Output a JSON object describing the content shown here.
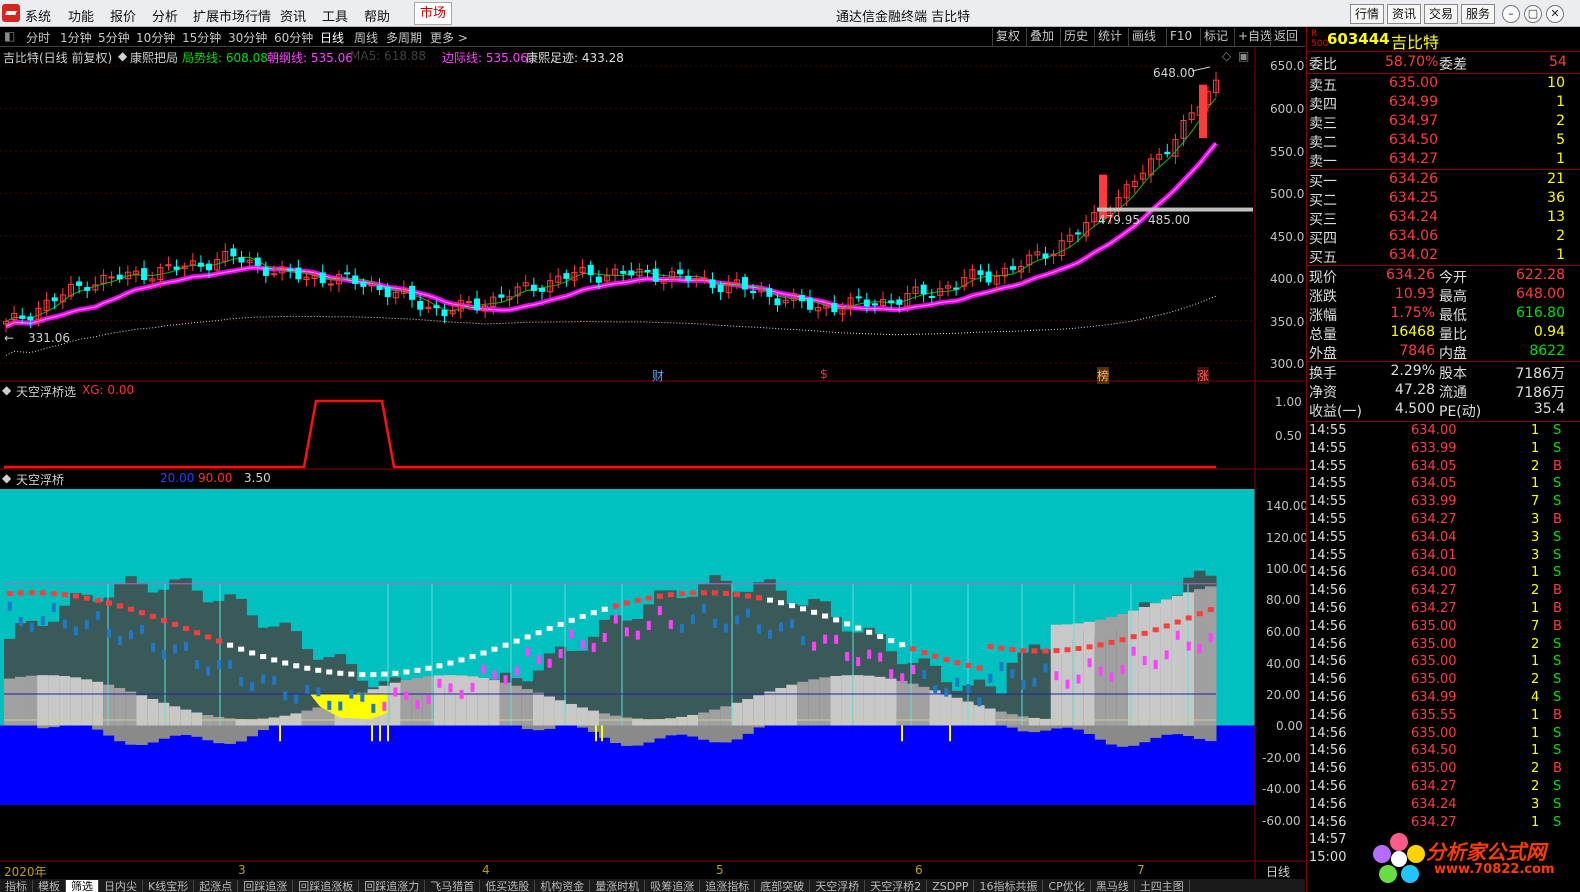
{
  "menu": {
    "items": [
      "系统",
      "功能",
      "报价",
      "分析",
      "扩展市场行情",
      "资讯",
      "工具",
      "帮助"
    ],
    "market": "市场",
    "title": "通达信金融终端  吉比特",
    "right_buttons": [
      "行情",
      "资讯",
      "交易",
      "服务"
    ],
    "window_controls": [
      "–",
      "▢",
      "✕"
    ]
  },
  "periods": {
    "items": [
      "分时",
      "1分钟",
      "5分钟",
      "10分钟",
      "15分钟",
      "30分钟",
      "60分钟",
      "日线",
      "周线",
      "多周期",
      "更多 >"
    ],
    "active": "日线",
    "tools": [
      "复权",
      "叠加",
      "历史",
      "统计",
      "画线",
      "F10",
      "标记",
      "+自选",
      "返回"
    ]
  },
  "main_panel": {
    "stock_label": "吉比特(日线 前复权)",
    "indicator_name": "康熙把局",
    "lines": [
      {
        "label": "局势线: 608.08",
        "color": "#00e000"
      },
      {
        "label": "朝纲线: 535.06",
        "color": "#ff40ff"
      },
      {
        "label": "MA5: 618.88",
        "color": "#404040"
      },
      {
        "label": "边际线: 535.06",
        "color": "#ff40ff"
      },
      {
        "label": "康熙足迹: 433.28",
        "color": "#e0e0e0"
      }
    ],
    "high_marker": "648.00",
    "low_marker": "331.06",
    "box_label": "479.95",
    "box_label2": "485.00",
    "axis": [
      "650.0",
      "600.0",
      "550.0",
      "500.0",
      "450.0",
      "400.0",
      "350.0",
      "300.0"
    ],
    "event_markers": [
      {
        "text": "财",
        "color": "#4da6ff"
      },
      {
        "text": "$",
        "color": "#ff3030"
      },
      {
        "text": "榜",
        "color": "#ffb060"
      },
      {
        "text": "涨",
        "color": "#ff6060"
      }
    ]
  },
  "panel2": {
    "name": "天空浮桥选",
    "value": "XG: 0.00",
    "axis": [
      "1.00",
      "0.50"
    ]
  },
  "panel3": {
    "name": "天空浮桥",
    "values": [
      "20.00",
      "90.00",
      "3.50"
    ],
    "axis": [
      "140.00",
      "120.00",
      "100.00",
      "80.00",
      "60.00",
      "40.00",
      "20.00",
      "0.00",
      "-20.00",
      "-40.00",
      "-60.00"
    ]
  },
  "date_axis": [
    "2020年",
    "3",
    "4",
    "5",
    "6",
    "7"
  ],
  "date_axis_right": "日线",
  "bottom_tabs": [
    "指标",
    "模板",
    "筛选",
    "日内尖",
    "K线宝形",
    "起涨点",
    "回踩追涨",
    "回踩追涨板",
    "回踩追涨力",
    "飞马猎首",
    "低买选股",
    "机构资金",
    "量涨时机",
    "吸筹追涨",
    "追涨指标",
    "底部突破",
    "天空浮桥",
    "天空浮桥2",
    "ZSDPP",
    "16指标共振",
    "CP优化",
    "黑马线",
    "土四主图"
  ],
  "bottom_active": "筛选",
  "quote": {
    "badge_top": "R",
    "badge_bot": "500",
    "code": "603444",
    "name": "吉比特",
    "wb": {
      "label": "委比",
      "value": "58.70%",
      "label2": "委差",
      "value2": "54"
    },
    "sell": [
      {
        "label": "卖五",
        "price": "635.00",
        "vol": "10"
      },
      {
        "label": "卖四",
        "price": "634.99",
        "vol": "1"
      },
      {
        "label": "卖三",
        "price": "634.97",
        "vol": "2"
      },
      {
        "label": "卖二",
        "price": "634.50",
        "vol": "5"
      },
      {
        "label": "卖一",
        "price": "634.27",
        "vol": "1"
      }
    ],
    "buy": [
      {
        "label": "买一",
        "price": "634.26",
        "vol": "21"
      },
      {
        "label": "买二",
        "price": "634.25",
        "vol": "36"
      },
      {
        "label": "买三",
        "price": "634.24",
        "vol": "13"
      },
      {
        "label": "买四",
        "price": "634.06",
        "vol": "2"
      },
      {
        "label": "买五",
        "price": "634.02",
        "vol": "1"
      }
    ],
    "stats1": [
      {
        "l1": "现价",
        "v1": "634.26",
        "c1": "red",
        "l2": "今开",
        "v2": "622.28",
        "c2": "red"
      },
      {
        "l1": "涨跌",
        "v1": "10.93",
        "c1": "red",
        "l2": "最高",
        "v2": "648.00",
        "c2": "red"
      },
      {
        "l1": "涨幅",
        "v1": "1.75%",
        "c1": "red",
        "l2": "最低",
        "v2": "616.80",
        "c2": "green"
      },
      {
        "l1": "总量",
        "v1": "16468",
        "c1": "yellow",
        "l2": "量比",
        "v2": "0.94",
        "c2": "yellow"
      },
      {
        "l1": "外盘",
        "v1": "7846",
        "c1": "red",
        "l2": "内盘",
        "v2": "8622",
        "c2": "green"
      }
    ],
    "stats2": [
      {
        "l1": "换手",
        "v1": "2.29%",
        "l2": "股本",
        "v2": "7186万"
      },
      {
        "l1": "净资",
        "v1": "47.28",
        "l2": "流通",
        "v2": "7186万"
      },
      {
        "l1": "收益(一)",
        "v1": "4.500",
        "l2": "PE(动)",
        "v2": "35.4"
      }
    ],
    "ticks": [
      {
        "t": "14:55",
        "p": "634.00",
        "v": "1",
        "d": "S"
      },
      {
        "t": "14:55",
        "p": "633.99",
        "v": "1",
        "d": "S"
      },
      {
        "t": "14:55",
        "p": "634.05",
        "v": "2",
        "d": "B"
      },
      {
        "t": "14:55",
        "p": "634.05",
        "v": "1",
        "d": "S"
      },
      {
        "t": "14:55",
        "p": "633.99",
        "v": "7",
        "d": "S"
      },
      {
        "t": "14:55",
        "p": "634.27",
        "v": "3",
        "d": "B"
      },
      {
        "t": "14:55",
        "p": "634.04",
        "v": "3",
        "d": "S"
      },
      {
        "t": "14:55",
        "p": "634.01",
        "v": "3",
        "d": "S"
      },
      {
        "t": "14:56",
        "p": "634.00",
        "v": "1",
        "d": "S"
      },
      {
        "t": "14:56",
        "p": "634.27",
        "v": "2",
        "d": "B"
      },
      {
        "t": "14:56",
        "p": "634.27",
        "v": "1",
        "d": "B"
      },
      {
        "t": "14:56",
        "p": "635.00",
        "v": "7",
        "d": "B"
      },
      {
        "t": "14:56",
        "p": "635.00",
        "v": "2",
        "d": "S"
      },
      {
        "t": "14:56",
        "p": "635.00",
        "v": "1",
        "d": "S"
      },
      {
        "t": "14:56",
        "p": "635.00",
        "v": "2",
        "d": "S"
      },
      {
        "t": "14:56",
        "p": "634.99",
        "v": "4",
        "d": "S"
      },
      {
        "t": "14:56",
        "p": "635.55",
        "v": "1",
        "d": "B"
      },
      {
        "t": "14:56",
        "p": "635.00",
        "v": "1",
        "d": "S"
      },
      {
        "t": "14:56",
        "p": "634.50",
        "v": "1",
        "d": "S"
      },
      {
        "t": "14:56",
        "p": "635.00",
        "v": "2",
        "d": "B"
      },
      {
        "t": "14:56",
        "p": "634.27",
        "v": "2",
        "d": "S"
      },
      {
        "t": "14:56",
        "p": "634.24",
        "v": "3",
        "d": "S"
      },
      {
        "t": "14:56",
        "p": "634.27",
        "v": "1",
        "d": "S"
      },
      {
        "t": "14:57",
        "p": "",
        "v": "",
        "d": ""
      },
      {
        "t": "15:00",
        "p": "",
        "v": "",
        "d": ""
      }
    ],
    "watermark": "分析家公式网",
    "watermark_url": "www.70822.com"
  },
  "colors": {
    "up": "#ff3c3c",
    "down": "#00ffff",
    "band": "#ff00ff",
    "cyan_bg": "#00c0c0",
    "blue_bg": "#0000ff"
  }
}
